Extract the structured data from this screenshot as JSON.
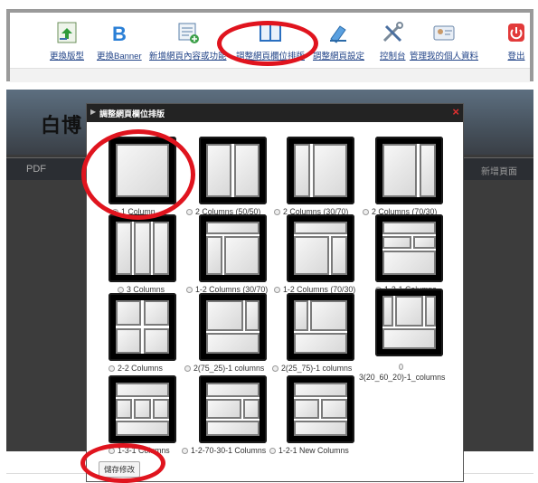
{
  "toolbar": {
    "items": [
      {
        "label": "更換版型",
        "icon": "template-swap-icon"
      },
      {
        "label": "更換Banner",
        "icon": "banner-b-icon"
      },
      {
        "label": "新增網頁內容或功能",
        "icon": "add-content-icon"
      },
      {
        "label": "調整網頁欄位排版",
        "icon": "column-layout-icon"
      },
      {
        "label": "調整網頁設定",
        "icon": "page-settings-icon"
      },
      {
        "label": "控制台",
        "icon": "tools-icon"
      },
      {
        "label": "管理我的個人資料",
        "icon": "profile-icon"
      },
      {
        "label": "登出",
        "icon": "power-icon"
      }
    ]
  },
  "background": {
    "title": "白博",
    "pdf_label": "PDF",
    "right_label": "新增頁面"
  },
  "modal": {
    "title": "調整網頁欄位排版",
    "close_glyph": "×",
    "options": [
      {
        "label": "1 Column",
        "selected": true
      },
      {
        "label": "2 Columns (50/50)",
        "selected": false
      },
      {
        "label": "2 Columns (30/70)",
        "selected": false
      },
      {
        "label": "2 Columns (70/30)",
        "selected": false
      },
      {
        "label": "3 Columns",
        "selected": false
      },
      {
        "label": "1-2 Columns (30/70)",
        "selected": false
      },
      {
        "label": "1-2 Columns (70/30)",
        "selected": false
      },
      {
        "label": "1-2-1 Columns",
        "selected": false
      },
      {
        "label": "2-2 Columns",
        "selected": false
      },
      {
        "label": "2(75_25)-1 columns",
        "selected": false
      },
      {
        "label": "2(25_75)-1 columns",
        "selected": false
      },
      {
        "label": "3(20_60_20)-1_columns",
        "selected": false
      },
      {
        "label": "1-3-1 Columns",
        "selected": false
      },
      {
        "label": "1-2-70-30-1 Columns",
        "selected": false
      },
      {
        "label": "1-2-1 New Columns",
        "selected": false
      }
    ],
    "save_label": "儲存修改"
  },
  "colors": {
    "annotation": "#e0141e",
    "modal_header": "#232323",
    "link": "#224488"
  }
}
